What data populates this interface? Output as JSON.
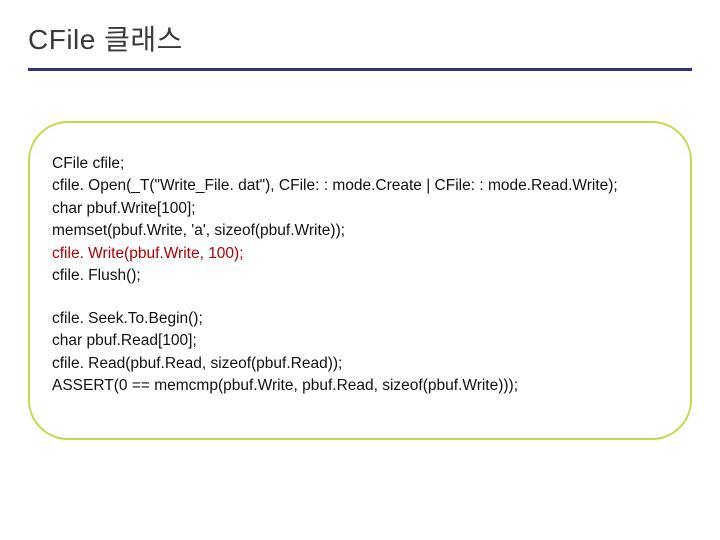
{
  "title": "CFile 클래스",
  "code": {
    "block1": [
      {
        "text": "CFile cfile;",
        "hl": false
      },
      {
        "text": "cfile. Open(_T(\"Write_File. dat\"), CFile: : mode.Create | CFile: : mode.Read.Write);",
        "hl": false
      },
      {
        "text": "char pbuf.Write[100];",
        "hl": false
      },
      {
        "text": "memset(pbuf.Write, 'a', sizeof(pbuf.Write));",
        "hl": false
      },
      {
        "text": "cfile. Write(pbuf.Write, 100);",
        "hl": true
      },
      {
        "text": "cfile. Flush();",
        "hl": false
      }
    ],
    "block2": [
      {
        "text": "cfile. Seek.To.Begin();",
        "hl": false
      },
      {
        "text": "char pbuf.Read[100];",
        "hl": false
      },
      {
        "text": "cfile. Read(pbuf.Read, sizeof(pbuf.Read));",
        "hl": false
      },
      {
        "text": "ASSERT(0 == memcmp(pbuf.Write, pbuf.Read, sizeof(pbuf.Write)));",
        "hl": false
      }
    ]
  }
}
